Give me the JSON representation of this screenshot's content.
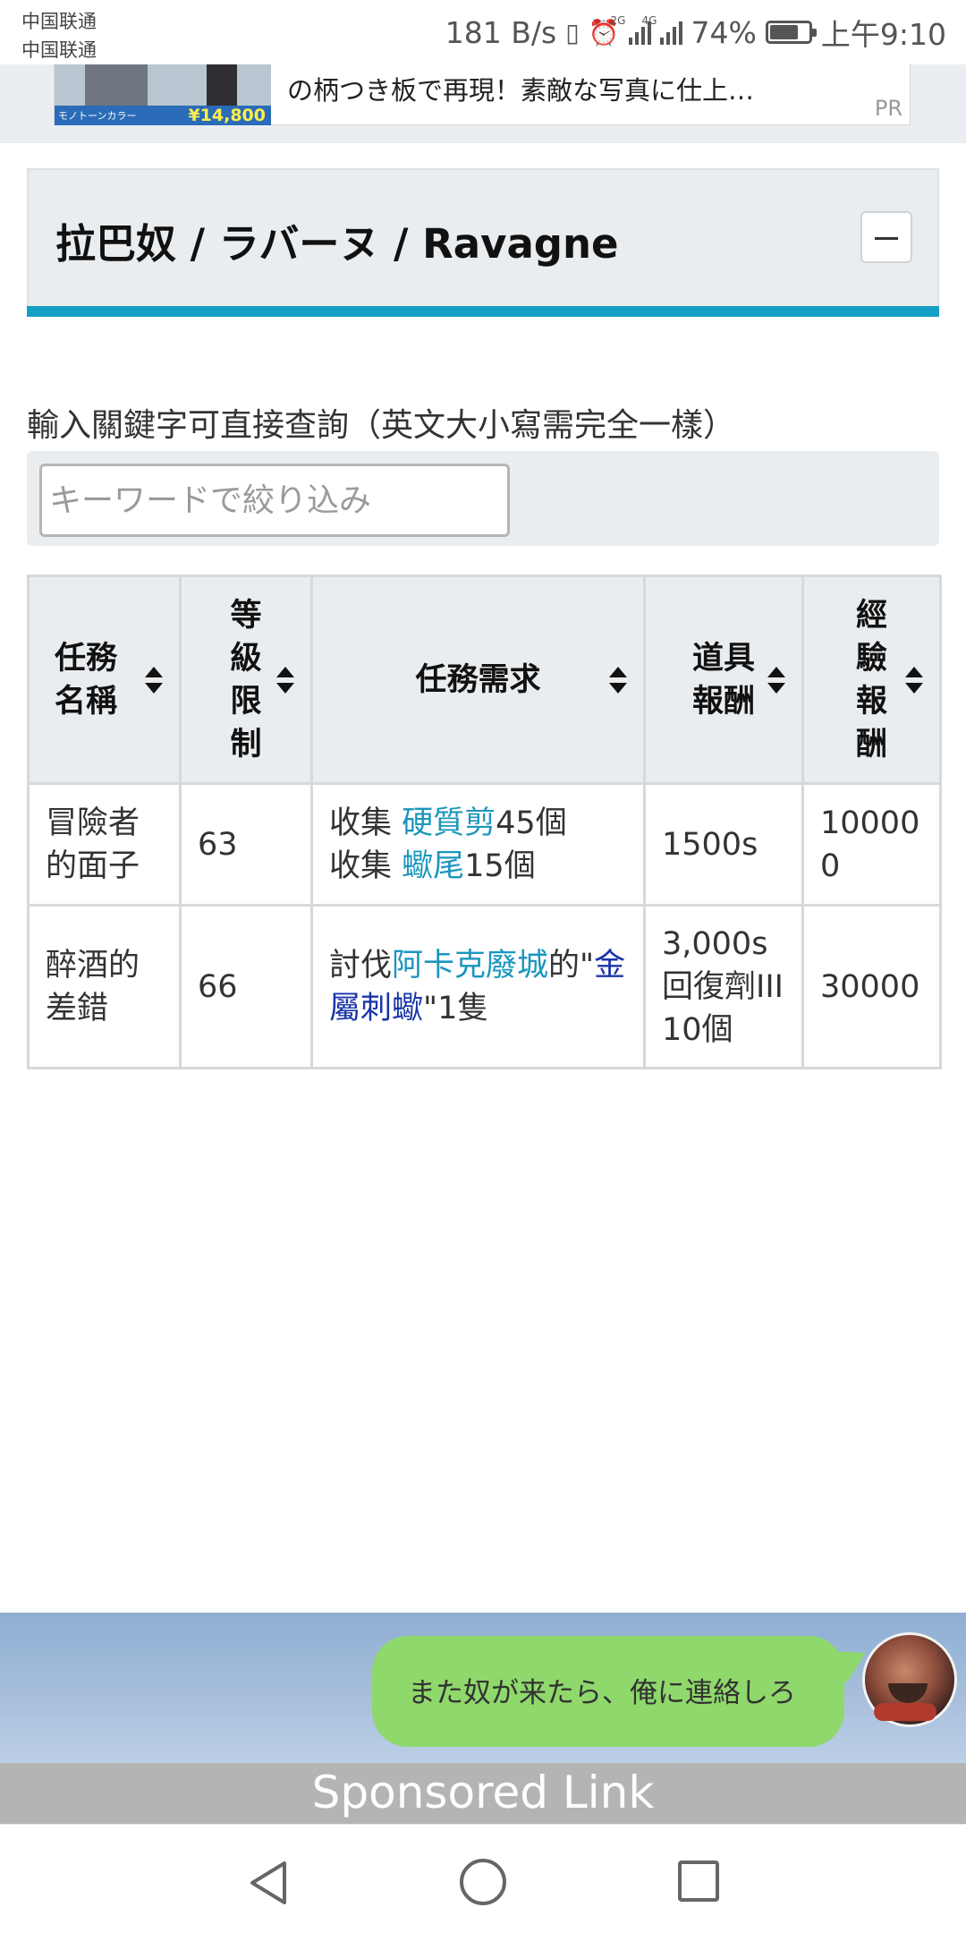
{
  "status_bar": {
    "carrier_1": "中国联通",
    "carrier_2": "中国联通",
    "speed": "181 B/s",
    "net_1": "2G",
    "net_2": "4G",
    "battery": "74%",
    "battery_level": 0.74,
    "time": "上午9:10"
  },
  "top_ad": {
    "text": "の柄つき板で再現！素敵な写真に仕上…",
    "price": "¥14,800",
    "image_caption": "モノトーンカラー",
    "pr_label": "PR"
  },
  "section": {
    "title": "拉巴奴 / ラバーヌ / Ravagne"
  },
  "search": {
    "hint": "輸入關鍵字可直接查詢（英文大小寫需完全一樣）",
    "placeholder": "キーワードで絞り込み"
  },
  "table": {
    "headers": [
      "任務\n名稱",
      "等\n級\n限\n制",
      "任務需求",
      "道具\n報酬",
      "經\n驗\n報\n酬"
    ],
    "rows": [
      {
        "name": "冒險者的面子",
        "level": "63",
        "req": {
          "line1_prefix": "收集 ",
          "line1_link": "硬質剪",
          "line1_suffix": "45個",
          "line2_prefix": "收集 ",
          "line2_link": "蠍尾",
          "line2_suffix": "15個"
        },
        "item_reward": "1500s",
        "exp_reward": "100000"
      },
      {
        "name": "醉酒的差錯",
        "level": "66",
        "req": {
          "prefix": "討伐",
          "link1": "阿卡克廢城",
          "mid": "的\"",
          "link2": "金屬刺蠍",
          "suffix": "\"1隻"
        },
        "item_reward": "3,000s回復劑III 10個",
        "exp_reward": "30000"
      }
    ]
  },
  "bottom_ad": {
    "bubble": "また奴が来たら、俺に連絡しろ",
    "label": "Sponsored Link"
  }
}
